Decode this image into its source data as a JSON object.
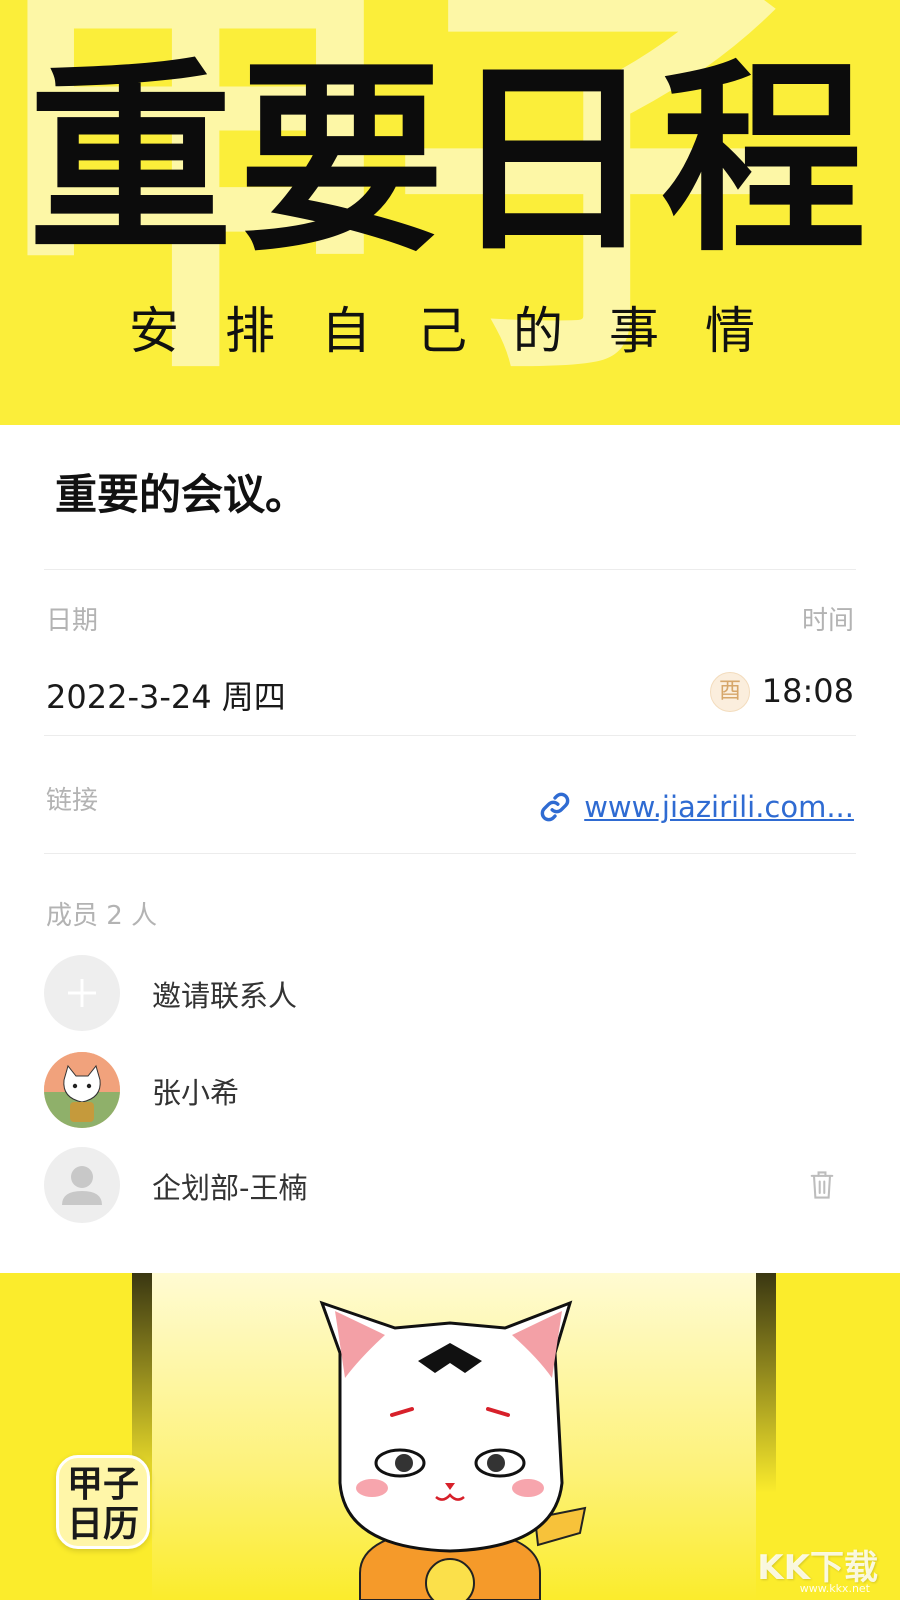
{
  "hero": {
    "background_glyphs": "甲子",
    "title": "重要日程",
    "subtitle": "安排自己的事情"
  },
  "event": {
    "title": "重要的会议。",
    "date_label": "日期",
    "date_value": "2022-3-24 周四",
    "time_label": "时间",
    "time_badge": "酉",
    "time_value": "18:08",
    "link_label": "链接",
    "link_value": "www.jiazirili.com..."
  },
  "members": {
    "header": "成员 2 人",
    "invite_label": "邀请联系人",
    "list": [
      {
        "name": "张小希",
        "avatar": "cat-avatar"
      },
      {
        "name": "企划部-王楠",
        "avatar": "person-placeholder-avatar",
        "deletable": true
      }
    ]
  },
  "footer": {
    "app_icon_line1": "甲子",
    "app_icon_line2": "日历",
    "watermark": "KK下载",
    "watermark_sub": "www.kkx.net"
  },
  "colors": {
    "banner_yellow": "#fbee3a",
    "link_blue": "#2f6bd2",
    "label_gray": "#b3b3b3"
  }
}
